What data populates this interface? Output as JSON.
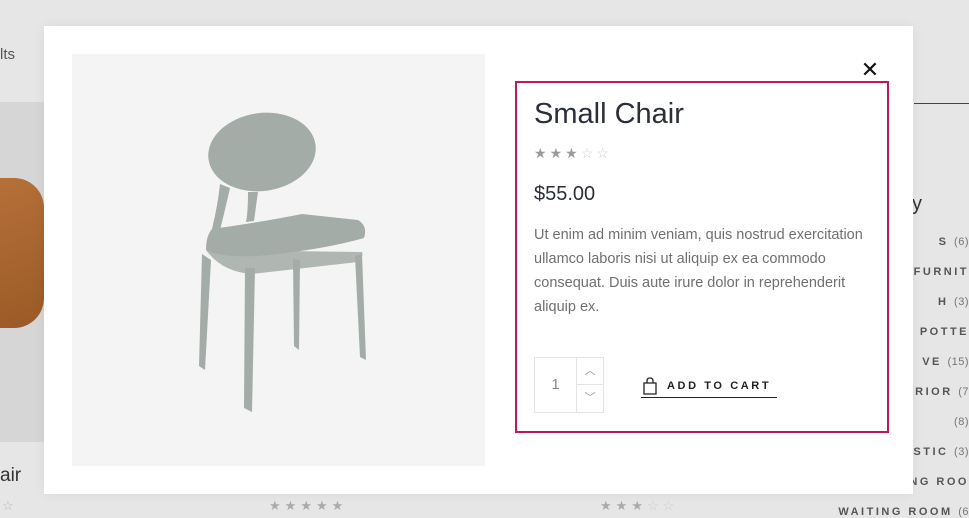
{
  "background": {
    "left_text": "lts",
    "left_product_title": "air",
    "left_star": "☆",
    "stars_middle": {
      "filled": 5,
      "total": 5
    },
    "stars_right": {
      "filled": 3,
      "total": 5
    },
    "category_heading": "y",
    "categories": [
      {
        "label": "S",
        "count": "(6)"
      },
      {
        "label": "FURNIT",
        "count": ""
      },
      {
        "label": "H",
        "count": "(3)"
      },
      {
        "label": "POTTE",
        "count": ""
      },
      {
        "label": "VE",
        "count": "(15)"
      },
      {
        "label": "ERIOR",
        "count": "(7"
      },
      {
        "label": "",
        "count": "(8)"
      },
      {
        "label": "STIC",
        "count": "(3)"
      },
      {
        "label": "NG ROO",
        "count": ""
      },
      {
        "label": "WAITING ROOM",
        "count": "(6"
      }
    ]
  },
  "modal": {
    "close_icon": "close-icon",
    "close_glyph": "✕",
    "product": {
      "title": "Small Chair",
      "rating": 3,
      "rating_max": 5,
      "price": "$55.00",
      "description": "Ut enim ad minim veniam, quis nostrud exercitation ullamco laboris nisi ut aliquip ex ea commodo consequat. Duis aute irure dolor in reprehenderit aliquip ex.",
      "image_icon": "chair-image"
    },
    "quantity": {
      "value": "1",
      "up_glyph": "︿",
      "down_glyph": "﹀"
    },
    "add_to_cart_label": "ADD TO CART",
    "add_to_cart_icon": "shopping-bag-icon"
  },
  "colors": {
    "highlight_border": "#c2185b",
    "chair": "#a3aca6"
  }
}
